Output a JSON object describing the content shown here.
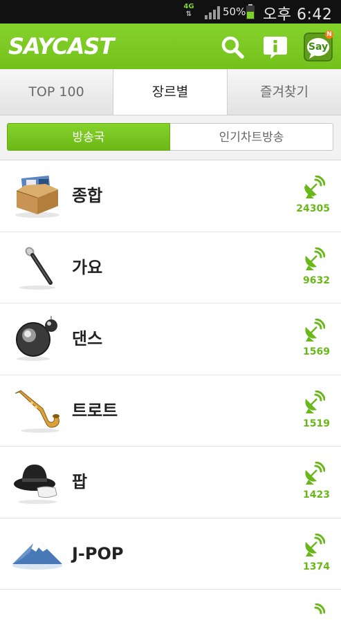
{
  "status_bar": {
    "network": "4G",
    "battery_percent": "50%",
    "time": "오후 6:42"
  },
  "app_bar": {
    "logo": "SAYCAST",
    "icons": [
      "search-icon",
      "info-icon",
      "say-chat-icon"
    ],
    "say_label": "Say",
    "say_badge": "N"
  },
  "tabs": [
    {
      "label": "TOP 100",
      "selected": false
    },
    {
      "label": "장르별",
      "selected": true
    },
    {
      "label": "즐겨찾기",
      "selected": false
    }
  ],
  "segments": [
    {
      "label": "방송국",
      "selected": true
    },
    {
      "label": "인기차트방송",
      "selected": false
    }
  ],
  "genres": [
    {
      "name": "종합",
      "count": "24305",
      "icon": "box-of-albums-icon"
    },
    {
      "name": "가요",
      "count": "9632",
      "icon": "microphone-icon"
    },
    {
      "name": "댄스",
      "count": "1569",
      "icon": "disco-ball-icon"
    },
    {
      "name": "트로트",
      "count": "1519",
      "icon": "saxophone-icon"
    },
    {
      "name": "팝",
      "count": "1423",
      "icon": "fedora-hat-icon"
    },
    {
      "name": "J-POP",
      "count": "1374",
      "icon": "mount-fuji-icon"
    }
  ],
  "colors": {
    "accent": "#7dcb24",
    "count_text": "#6ab71a",
    "status_bg": "#111111"
  }
}
